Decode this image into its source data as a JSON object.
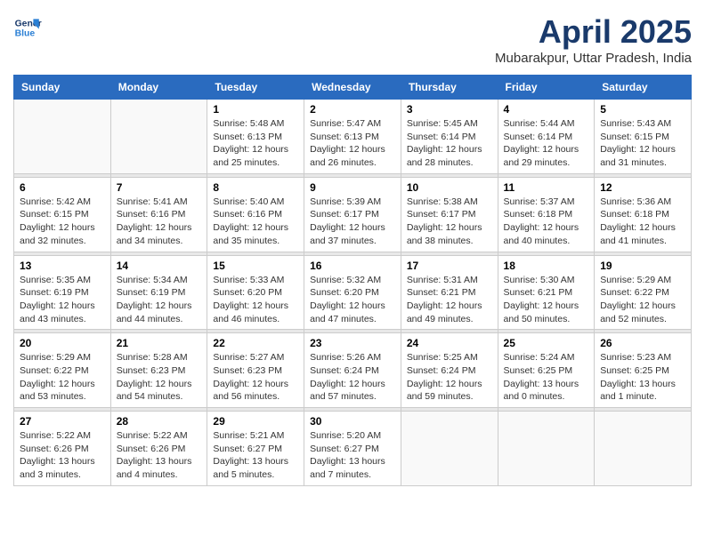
{
  "header": {
    "logo_line1": "General",
    "logo_line2": "Blue",
    "title": "April 2025",
    "subtitle": "Mubarakpur, Uttar Pradesh, India"
  },
  "calendar": {
    "headers": [
      "Sunday",
      "Monday",
      "Tuesday",
      "Wednesday",
      "Thursday",
      "Friday",
      "Saturday"
    ],
    "weeks": [
      [
        {
          "day": "",
          "info": ""
        },
        {
          "day": "",
          "info": ""
        },
        {
          "day": "1",
          "info": "Sunrise: 5:48 AM\nSunset: 6:13 PM\nDaylight: 12 hours and 25 minutes."
        },
        {
          "day": "2",
          "info": "Sunrise: 5:47 AM\nSunset: 6:13 PM\nDaylight: 12 hours and 26 minutes."
        },
        {
          "day": "3",
          "info": "Sunrise: 5:45 AM\nSunset: 6:14 PM\nDaylight: 12 hours and 28 minutes."
        },
        {
          "day": "4",
          "info": "Sunrise: 5:44 AM\nSunset: 6:14 PM\nDaylight: 12 hours and 29 minutes."
        },
        {
          "day": "5",
          "info": "Sunrise: 5:43 AM\nSunset: 6:15 PM\nDaylight: 12 hours and 31 minutes."
        }
      ],
      [
        {
          "day": "6",
          "info": "Sunrise: 5:42 AM\nSunset: 6:15 PM\nDaylight: 12 hours and 32 minutes."
        },
        {
          "day": "7",
          "info": "Sunrise: 5:41 AM\nSunset: 6:16 PM\nDaylight: 12 hours and 34 minutes."
        },
        {
          "day": "8",
          "info": "Sunrise: 5:40 AM\nSunset: 6:16 PM\nDaylight: 12 hours and 35 minutes."
        },
        {
          "day": "9",
          "info": "Sunrise: 5:39 AM\nSunset: 6:17 PM\nDaylight: 12 hours and 37 minutes."
        },
        {
          "day": "10",
          "info": "Sunrise: 5:38 AM\nSunset: 6:17 PM\nDaylight: 12 hours and 38 minutes."
        },
        {
          "day": "11",
          "info": "Sunrise: 5:37 AM\nSunset: 6:18 PM\nDaylight: 12 hours and 40 minutes."
        },
        {
          "day": "12",
          "info": "Sunrise: 5:36 AM\nSunset: 6:18 PM\nDaylight: 12 hours and 41 minutes."
        }
      ],
      [
        {
          "day": "13",
          "info": "Sunrise: 5:35 AM\nSunset: 6:19 PM\nDaylight: 12 hours and 43 minutes."
        },
        {
          "day": "14",
          "info": "Sunrise: 5:34 AM\nSunset: 6:19 PM\nDaylight: 12 hours and 44 minutes."
        },
        {
          "day": "15",
          "info": "Sunrise: 5:33 AM\nSunset: 6:20 PM\nDaylight: 12 hours and 46 minutes."
        },
        {
          "day": "16",
          "info": "Sunrise: 5:32 AM\nSunset: 6:20 PM\nDaylight: 12 hours and 47 minutes."
        },
        {
          "day": "17",
          "info": "Sunrise: 5:31 AM\nSunset: 6:21 PM\nDaylight: 12 hours and 49 minutes."
        },
        {
          "day": "18",
          "info": "Sunrise: 5:30 AM\nSunset: 6:21 PM\nDaylight: 12 hours and 50 minutes."
        },
        {
          "day": "19",
          "info": "Sunrise: 5:29 AM\nSunset: 6:22 PM\nDaylight: 12 hours and 52 minutes."
        }
      ],
      [
        {
          "day": "20",
          "info": "Sunrise: 5:29 AM\nSunset: 6:22 PM\nDaylight: 12 hours and 53 minutes."
        },
        {
          "day": "21",
          "info": "Sunrise: 5:28 AM\nSunset: 6:23 PM\nDaylight: 12 hours and 54 minutes."
        },
        {
          "day": "22",
          "info": "Sunrise: 5:27 AM\nSunset: 6:23 PM\nDaylight: 12 hours and 56 minutes."
        },
        {
          "day": "23",
          "info": "Sunrise: 5:26 AM\nSunset: 6:24 PM\nDaylight: 12 hours and 57 minutes."
        },
        {
          "day": "24",
          "info": "Sunrise: 5:25 AM\nSunset: 6:24 PM\nDaylight: 12 hours and 59 minutes."
        },
        {
          "day": "25",
          "info": "Sunrise: 5:24 AM\nSunset: 6:25 PM\nDaylight: 13 hours and 0 minutes."
        },
        {
          "day": "26",
          "info": "Sunrise: 5:23 AM\nSunset: 6:25 PM\nDaylight: 13 hours and 1 minute."
        }
      ],
      [
        {
          "day": "27",
          "info": "Sunrise: 5:22 AM\nSunset: 6:26 PM\nDaylight: 13 hours and 3 minutes."
        },
        {
          "day": "28",
          "info": "Sunrise: 5:22 AM\nSunset: 6:26 PM\nDaylight: 13 hours and 4 minutes."
        },
        {
          "day": "29",
          "info": "Sunrise: 5:21 AM\nSunset: 6:27 PM\nDaylight: 13 hours and 5 minutes."
        },
        {
          "day": "30",
          "info": "Sunrise: 5:20 AM\nSunset: 6:27 PM\nDaylight: 13 hours and 7 minutes."
        },
        {
          "day": "",
          "info": ""
        },
        {
          "day": "",
          "info": ""
        },
        {
          "day": "",
          "info": ""
        }
      ]
    ]
  }
}
